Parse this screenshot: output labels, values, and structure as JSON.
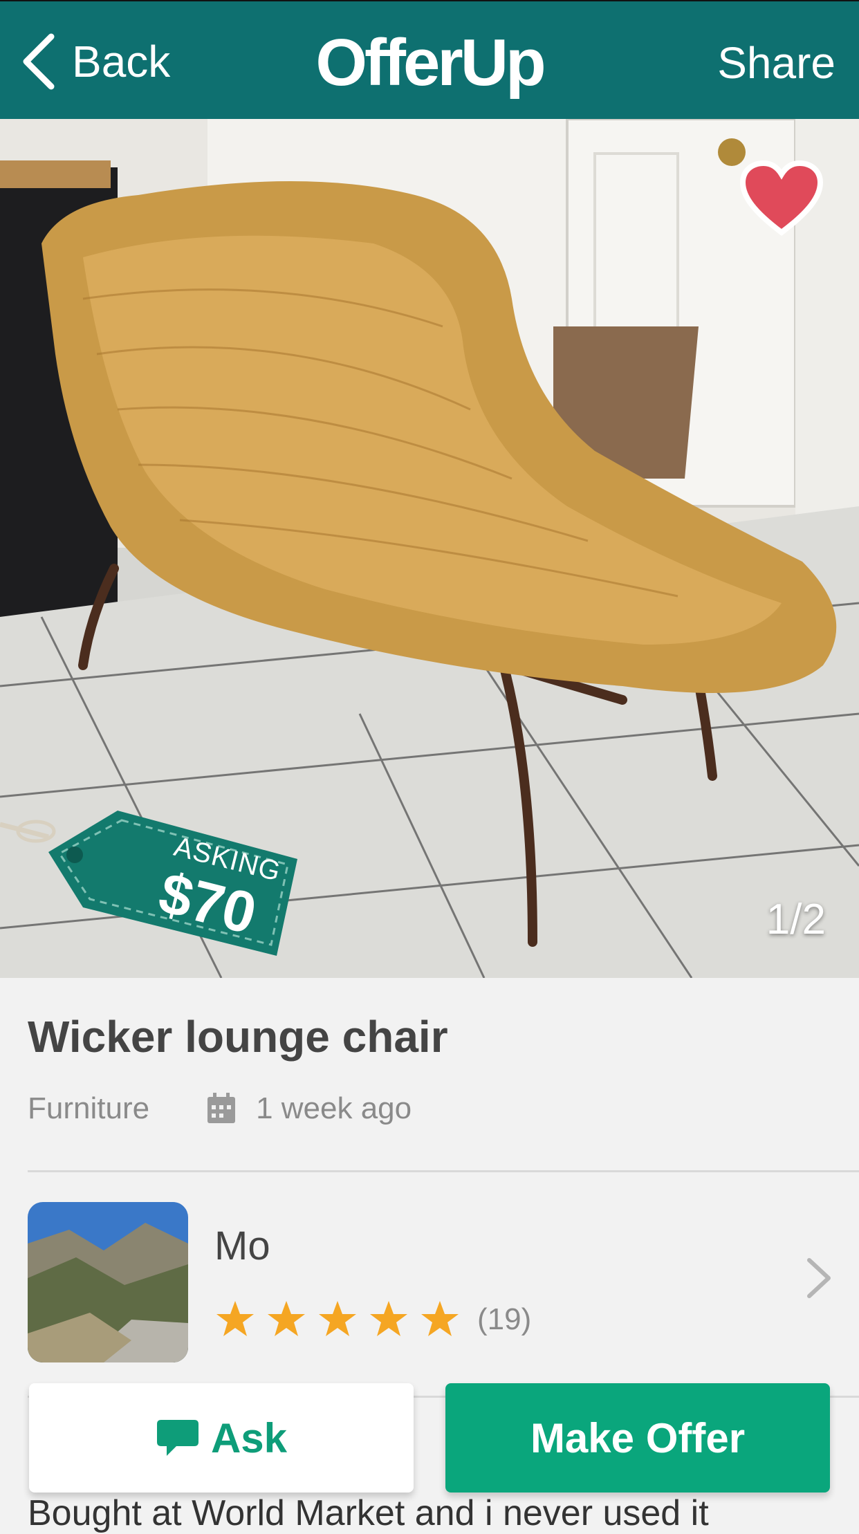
{
  "nav": {
    "back_label": "Back",
    "logo": "OfferUp",
    "share_label": "Share"
  },
  "listing": {
    "price_tag_label": "ASKING",
    "price": "$70",
    "photo_counter": "1/2",
    "title": "Wicker lounge chair",
    "category": "Furniture",
    "posted": "1 week ago",
    "description": "Bought at World Market and i never used it"
  },
  "seller": {
    "name": "Mo",
    "rating": 5,
    "rating_max": 5,
    "rating_count": "(19)"
  },
  "actions": {
    "ask_label": "Ask",
    "offer_label": "Make Offer"
  },
  "colors": {
    "brand": "#0e7070",
    "accent": "#0aa67c",
    "star": "#f5a623",
    "favorite": "#e04a5a"
  },
  "icons": {
    "back": "chevron-left-icon",
    "favorite": "heart-icon",
    "calendar": "calendar-icon",
    "star": "star-icon",
    "chat": "chat-bubble-icon",
    "chevron": "chevron-right-icon"
  }
}
